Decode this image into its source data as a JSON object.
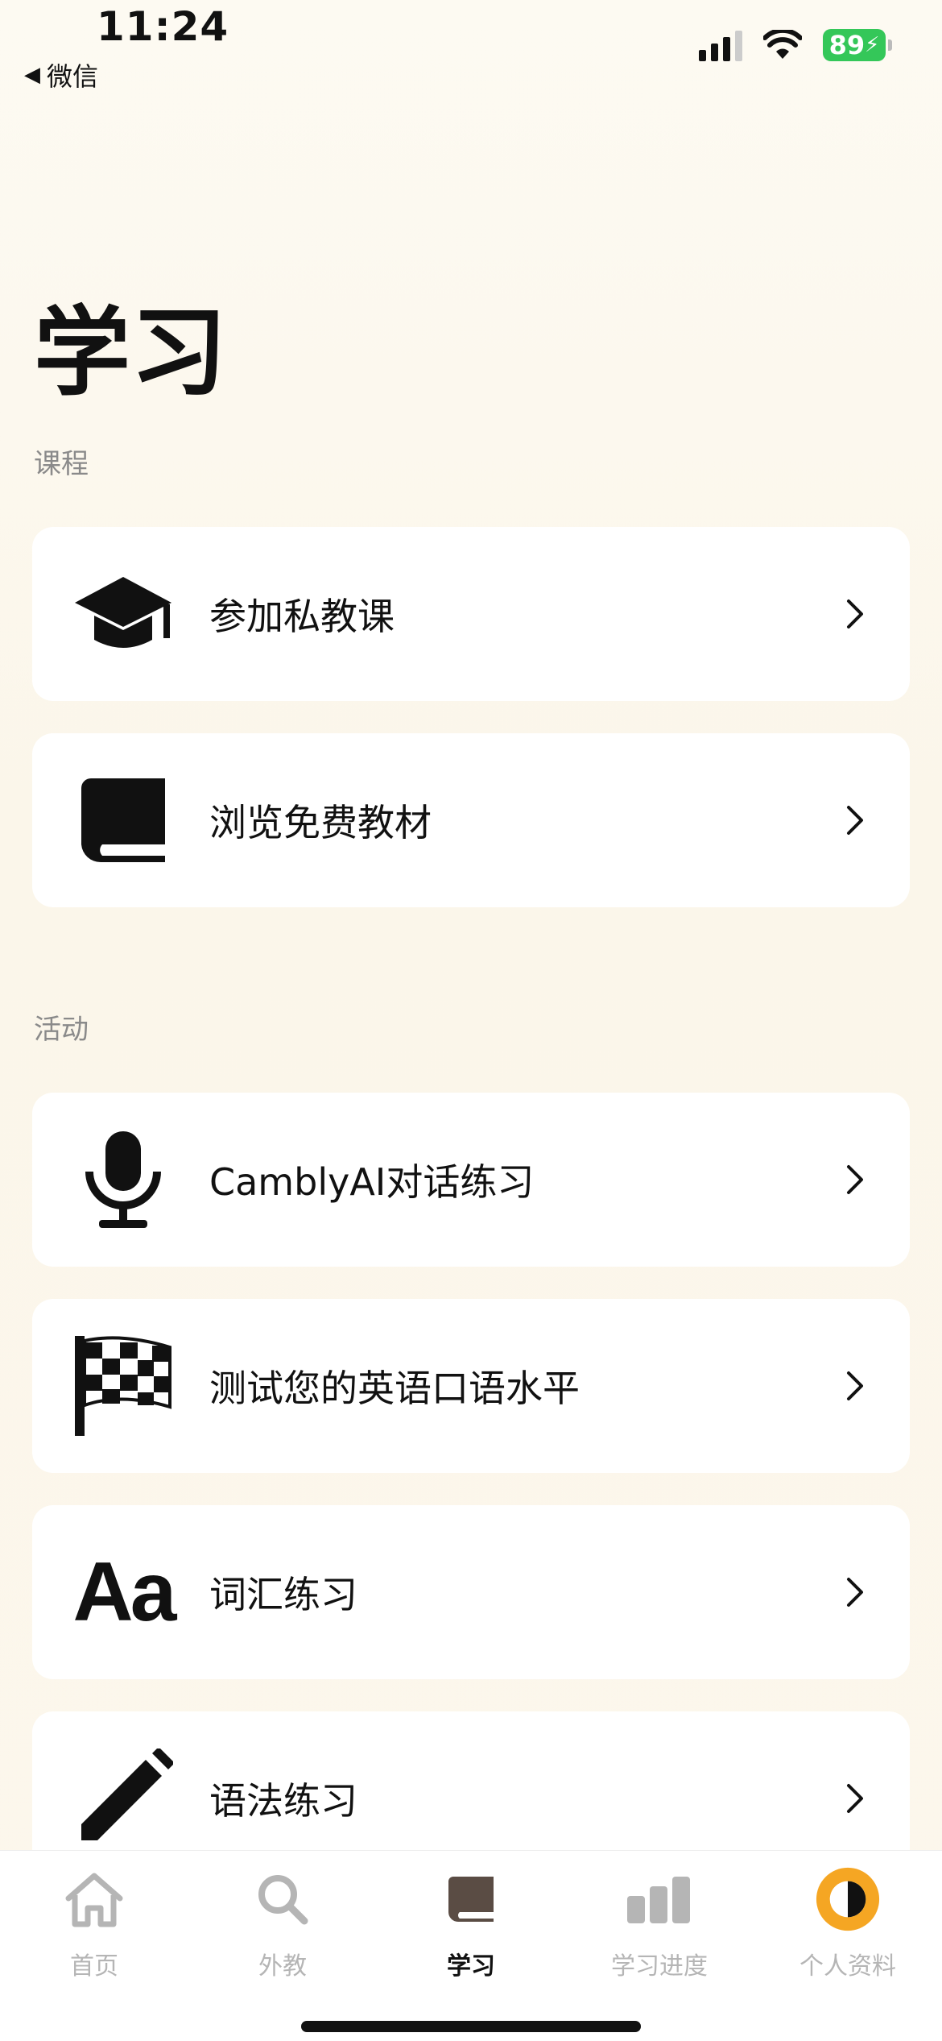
{
  "status_bar": {
    "time": "11:24",
    "back_app": "微信",
    "battery": "89"
  },
  "page": {
    "title": "学习"
  },
  "sections": {
    "courses": {
      "label": "课程",
      "items": [
        {
          "label": "参加私教课",
          "icon": "graduation-cap-icon"
        },
        {
          "label": "浏览免费教材",
          "icon": "book-icon"
        }
      ]
    },
    "activities": {
      "label": "活动",
      "items": [
        {
          "label": "CamblyAI对话练习",
          "icon": "microphone-icon"
        },
        {
          "label": "测试您的英语口语水平",
          "icon": "checkered-flag-icon"
        },
        {
          "label": "词汇练习",
          "icon": "text-aa-icon",
          "icon_text": "Aa"
        },
        {
          "label": "语法练习",
          "icon": "pencil-icon"
        }
      ]
    }
  },
  "tab_bar": {
    "tabs": [
      {
        "label": "首页",
        "icon": "home-icon",
        "active": false
      },
      {
        "label": "外教",
        "icon": "search-icon",
        "active": false
      },
      {
        "label": "学习",
        "icon": "book-icon",
        "active": true
      },
      {
        "label": "学习进度",
        "icon": "bar-chart-icon",
        "active": false
      },
      {
        "label": "个人资料",
        "icon": "avatar-icon",
        "active": false
      }
    ]
  },
  "colors": {
    "battery": "#34c759",
    "accent_avatar": "#f5a623",
    "inactive_tab": "#b5b5b5"
  }
}
